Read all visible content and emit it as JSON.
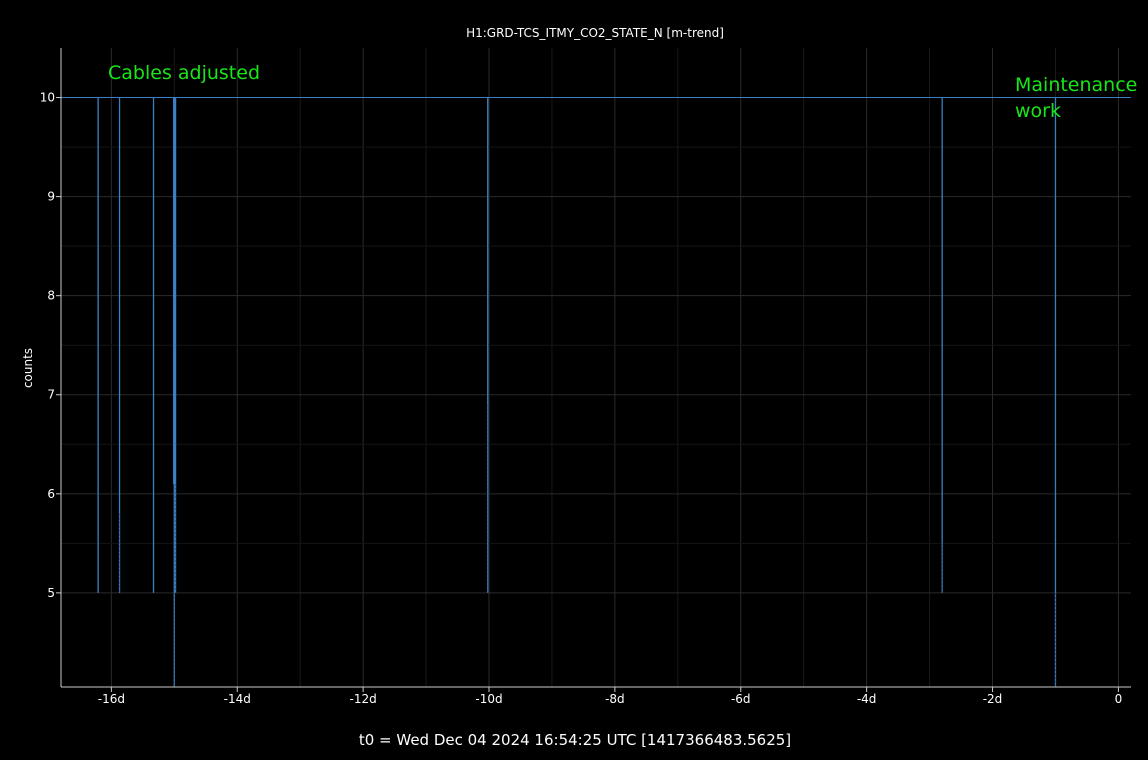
{
  "chart_data": {
    "type": "line",
    "title": "H1:GRD-TCS_ITMY_CO2_STATE_N [m-trend]",
    "xlabel": "t0 = Wed Dec 04 2024 16:54:25 UTC [1417366483.5625]",
    "ylabel": "counts",
    "x_unit": "days relative to t0",
    "xlim": [
      -16.8,
      0.2
    ],
    "ylim": [
      4.05,
      10.5
    ],
    "x_ticks": [
      -16,
      -14,
      -12,
      -10,
      -8,
      -6,
      -4,
      -2,
      0
    ],
    "x_tick_labels": [
      "-16d",
      "-14d",
      "-12d",
      "-10d",
      "-8d",
      "-6d",
      "-4d",
      "-2d",
      "0"
    ],
    "y_ticks": [
      5,
      6,
      7,
      8,
      9,
      10
    ],
    "y_tick_labels": [
      "5",
      "6",
      "7",
      "8",
      "9",
      "10"
    ],
    "grid": true,
    "colors": {
      "line": "#3d7fc4",
      "annotation": "#19e619",
      "grid": "#2b2b2b",
      "axis": "#cccccc"
    },
    "series": [
      {
        "baseline": 10,
        "dips": [
          {
            "x": -16.21,
            "min": 5,
            "mean": 5.0
          },
          {
            "x": -15.87,
            "min": 5,
            "mean": 5.8
          },
          {
            "x": -15.33,
            "min": 5,
            "mean": 5.0
          },
          {
            "x": -15.0,
            "min": 4.05,
            "mean": 5.0
          },
          {
            "x": -14.98,
            "min": 5,
            "mean": 6.1
          },
          {
            "x": -10.02,
            "min": 5,
            "mean": 6.9
          },
          {
            "x": -2.8,
            "min": 5,
            "mean": 5.5
          },
          {
            "x": -1.0,
            "min": 4.05,
            "mean": 5.0
          }
        ]
      }
    ],
    "annotations": [
      {
        "text": "Cables adjusted"
      },
      {
        "text": "Maintenance",
        "text2": "work"
      }
    ]
  }
}
